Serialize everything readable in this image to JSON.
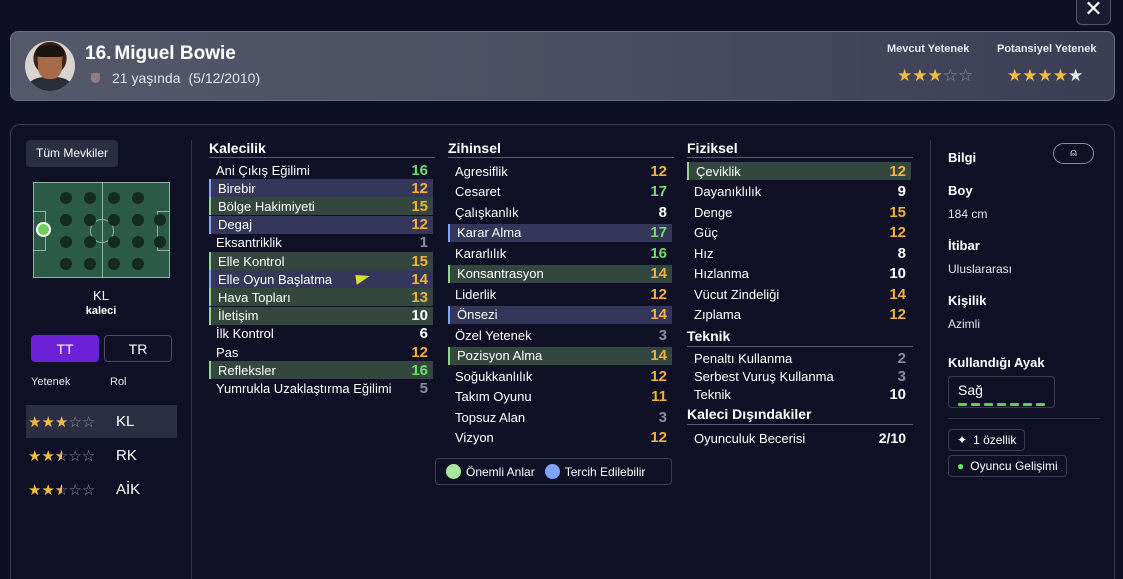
{
  "close_label": "✕",
  "player": {
    "number": "16.",
    "name": "Miguel Bowie",
    "age": "21 yaşında",
    "dob": "(5/12/2010)",
    "current_ability_label": "Mevcut Yetenek",
    "potential_ability_label": "Potansiyel Yetenek",
    "current_stars": 3,
    "potential_stars": 4
  },
  "left": {
    "positions_button": "Tüm Mevkiler",
    "position_code": "KL",
    "position_name": "kaleci",
    "toggle_on": "TT",
    "toggle_off": "TR",
    "col_ability": "Yetenek",
    "col_role": "Rol",
    "roles": [
      {
        "name": "KL",
        "stars": 3
      },
      {
        "name": "RK",
        "stars": 2.5
      },
      {
        "name": "AİK",
        "stars": 2.5
      }
    ]
  },
  "goalkeeping": {
    "title": "Kalecilik",
    "attrs": [
      {
        "label": "Ani Çıkış Eğilimi",
        "value": "16"
      },
      {
        "label": "Birebir",
        "value": "12"
      },
      {
        "label": "Bölge Hakimiyeti",
        "value": "15"
      },
      {
        "label": "Degaj",
        "value": "12"
      },
      {
        "label": "Eksantriklik",
        "value": "1"
      },
      {
        "label": "Elle Kontrol",
        "value": "15"
      },
      {
        "label": "Elle Oyun Başlatma",
        "value": "14"
      },
      {
        "label": "Hava Topları",
        "value": "13"
      },
      {
        "label": "İletişim",
        "value": "10"
      },
      {
        "label": "İlk Kontrol",
        "value": "6"
      },
      {
        "label": "Pas",
        "value": "12"
      },
      {
        "label": "Refleksler",
        "value": "16"
      },
      {
        "label": "Yumrukla Uzaklaştırma Eğilimi",
        "value": "5"
      }
    ]
  },
  "mental": {
    "title": "Zihinsel",
    "attrs": [
      {
        "label": "Agresiflik",
        "value": "12"
      },
      {
        "label": "Cesaret",
        "value": "17"
      },
      {
        "label": "Çalışkanlık",
        "value": "8"
      },
      {
        "label": "Karar Alma",
        "value": "17"
      },
      {
        "label": "Kararlılık",
        "value": "16"
      },
      {
        "label": "Konsantrasyon",
        "value": "14"
      },
      {
        "label": "Liderlik",
        "value": "12"
      },
      {
        "label": "Önsezi",
        "value": "14"
      },
      {
        "label": "Özel Yetenek",
        "value": "3"
      },
      {
        "label": "Pozisyon Alma",
        "value": "14"
      },
      {
        "label": "Soğukkanlılık",
        "value": "12"
      },
      {
        "label": "Takım Oyunu",
        "value": "11"
      },
      {
        "label": "Topsuz Alan",
        "value": "3"
      },
      {
        "label": "Vizyon",
        "value": "12"
      }
    ]
  },
  "physical": {
    "title": "Fiziksel",
    "attrs": [
      {
        "label": "Çeviklik",
        "value": "12"
      },
      {
        "label": "Dayanıklılık",
        "value": "9"
      },
      {
        "label": "Denge",
        "value": "15"
      },
      {
        "label": "Güç",
        "value": "12"
      },
      {
        "label": "Hız",
        "value": "8"
      },
      {
        "label": "Hızlanma",
        "value": "10"
      },
      {
        "label": "Vücut Zindeliği",
        "value": "14"
      },
      {
        "label": "Zıplama",
        "value": "12"
      }
    ]
  },
  "technical": {
    "title": "Teknik",
    "attrs": [
      {
        "label": "Penaltı Kullanma",
        "value": "2"
      },
      {
        "label": "Serbest Vuruş Kullanma",
        "value": "3"
      },
      {
        "label": "Teknik",
        "value": "10"
      }
    ]
  },
  "outfield": {
    "title": "Kaleci Dışındakiler",
    "attrs": [
      {
        "label": "Oyunculuk Becerisi",
        "value": "2/10"
      }
    ]
  },
  "legend": {
    "key_moments": "Önemli Anlar",
    "preferred": "Tercih Edilebilir"
  },
  "info": {
    "title": "Bilgi",
    "height_label": "Boy",
    "height_value": "184 cm",
    "reputation_label": "İtibar",
    "reputation_value": "Uluslararası",
    "personality_label": "Kişilik",
    "personality_value": "Azimli",
    "foot_label": "Kullandığı Ayak",
    "foot_value": "Sağ",
    "traits_chip": "1 özellik",
    "development_chip": "Oyuncu Gelişimi"
  },
  "colors": {
    "accent": "#6b22d6",
    "green": "#6ee06a",
    "orange": "#f2b23a",
    "key_moment": "#8fd68a",
    "preferred": "#7fa6ff"
  }
}
